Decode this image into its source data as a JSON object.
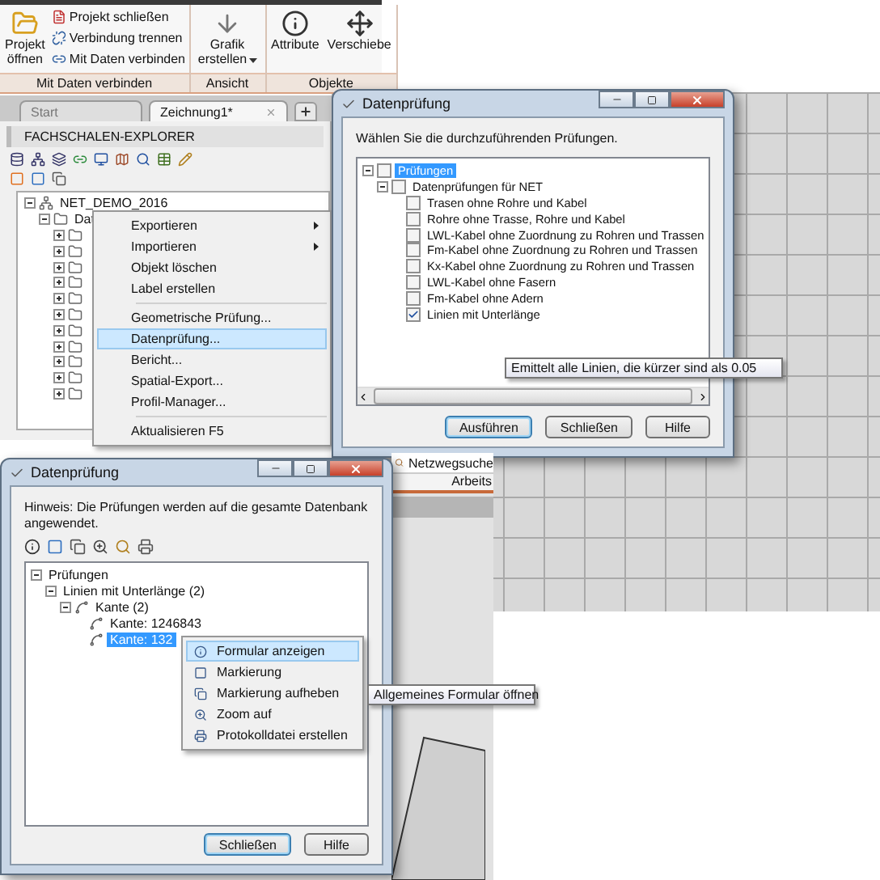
{
  "ribbon": [
    {
      "label": "Mit Daten verbinden",
      "buttons": [
        {
          "kind": "large",
          "label": "Projekt öffnen"
        },
        {
          "kind": "small",
          "label": "Projekt schließen"
        },
        {
          "kind": "small",
          "label": "Verbindung trennen"
        },
        {
          "kind": "small",
          "label": "Mit Daten verbinden"
        }
      ]
    },
    {
      "label": "Ansicht",
      "buttons": [
        {
          "kind": "dropdown",
          "label": "Grafik erstellen"
        }
      ]
    },
    {
      "label": "Objekte",
      "buttons": [
        {
          "kind": "large",
          "label": "Attribute"
        },
        {
          "kind": "large",
          "label": "Verschiebe"
        }
      ]
    }
  ],
  "tabs": [
    {
      "label": "Start",
      "selected": false,
      "closable": false
    },
    {
      "label": "Zeichnung1*",
      "selected": true,
      "closable": true
    }
  ],
  "explorer": {
    "title": "FACHSCHALEN-EXPLORER",
    "tree": [
      {
        "label": "NET_DEMO_2016",
        "expanded": true,
        "children": [
          {
            "label": "Dat",
            "expanded": true,
            "children": [
              {
                "expanded": false
              },
              {
                "expanded": false
              },
              {
                "expanded": false
              },
              {
                "expanded": false
              },
              {
                "expanded": false
              },
              {
                "expanded": false
              },
              {
                "expanded": false
              },
              {
                "expanded": false
              },
              {
                "expanded": false
              },
              {
                "expanded": false
              },
              {
                "expanded": false
              }
            ]
          }
        ]
      }
    ]
  },
  "context_menu": [
    {
      "kind": "item",
      "label": "Exportieren",
      "submenu": true,
      "selected": false
    },
    {
      "kind": "item",
      "label": "Importieren",
      "submenu": true,
      "selected": false
    },
    {
      "kind": "item",
      "label": "Objekt löschen",
      "submenu": false,
      "selected": false
    },
    {
      "kind": "item",
      "label": "Label erstellen",
      "submenu": false,
      "selected": false
    },
    {
      "kind": "separator"
    },
    {
      "kind": "item",
      "label": "Geometrische Prüfung...",
      "submenu": false,
      "selected": false
    },
    {
      "kind": "item",
      "label": "Datenprüfung...",
      "submenu": false,
      "selected": true
    },
    {
      "kind": "item",
      "label": "Bericht...",
      "submenu": false,
      "selected": false
    },
    {
      "kind": "item",
      "label": "Spatial-Export...",
      "submenu": false,
      "selected": false
    },
    {
      "kind": "item",
      "label": "Profil-Manager...",
      "submenu": false,
      "selected": false
    },
    {
      "kind": "separator"
    },
    {
      "kind": "item",
      "label": "Aktualisieren F5",
      "submenu": false,
      "selected": false
    }
  ],
  "check_dialog": {
    "title": "Datenprüfung",
    "instruction": "Wählen Sie die durchzuführenden Prüfungen.",
    "tree": [
      {
        "label": "Prüfungen",
        "checked": false,
        "selected": true,
        "expanded": true,
        "children": [
          {
            "label": "Datenprüfungen für NET",
            "checked": false,
            "selected": false,
            "expanded": true,
            "children": [
              {
                "label": "Trasen ohne Rohre und Kabel",
                "checked": false,
                "selected": false
              },
              {
                "label": "Rohre ohne Trasse, Rohre und Kabel",
                "checked": false,
                "selected": false
              },
              {
                "label": "LWL-Kabel ohne Zuordnung zu Rohren und Trassen",
                "checked": false,
                "selected": false
              },
              {
                "label": "Fm-Kabel ohne Zuordnung zu Rohren und Trassen",
                "checked": false,
                "selected": false
              },
              {
                "label": "Kx-Kabel ohne Zuordnung zu Rohren und Trassen",
                "checked": false,
                "selected": false
              },
              {
                "label": "LWL-Kabel ohne Fasern",
                "checked": false,
                "selected": false
              },
              {
                "label": "Fm-Kabel ohne Adern",
                "checked": false,
                "selected": false
              },
              {
                "label": "Linien mit Unterlänge",
                "checked": true,
                "selected": false
              }
            ]
          }
        ]
      }
    ],
    "tooltip": "Emittelt alle Linien, die kürzer sind als 0.05",
    "buttons": [
      {
        "label": "Ausführen",
        "default": true
      },
      {
        "label": "Schließen",
        "default": false
      },
      {
        "label": "Hilfe",
        "default": false
      }
    ]
  },
  "result_dialog": {
    "title": "Datenprüfung",
    "hint": "Hinweis: Die Prüfungen werden auf die gesamte Datenbank angewendet.",
    "tree": [
      {
        "label": "Prüfungen",
        "selected": false,
        "expanded": true,
        "children": [
          {
            "label": "Linien mit Unterlänge (2)",
            "selected": false,
            "expanded": true,
            "children": [
              {
                "label": "Kante (2)",
                "selected": false,
                "expanded": true,
                "children": [
                  {
                    "label": "Kante: 1246843",
                    "selected": false
                  },
                  {
                    "label": "Kante: 132",
                    "selected": true
                  }
                ]
              }
            ]
          }
        ]
      }
    ],
    "context_menu": [
      {
        "label": "Formular anzeigen",
        "selected": true
      },
      {
        "label": "Markierung",
        "selected": false
      },
      {
        "label": "Markierung aufheben",
        "selected": false
      },
      {
        "label": "Zoom auf",
        "selected": false
      },
      {
        "label": "Protokolldatei erstellen",
        "selected": false
      }
    ],
    "tooltip": "Allgemeines Formular öffnen",
    "buttons": [
      {
        "label": "Schließen",
        "default": true
      },
      {
        "label": "Hilfe",
        "default": false
      }
    ]
  },
  "side_panel": {
    "tab": "Netzwegsuche",
    "caption": "Arbeits"
  }
}
